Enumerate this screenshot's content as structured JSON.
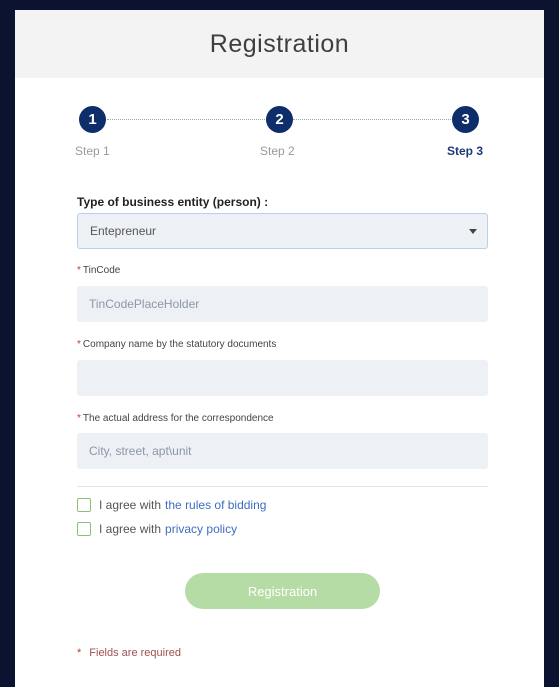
{
  "header": {
    "title": "Registration"
  },
  "steps": [
    {
      "number": "1",
      "label": "Step 1"
    },
    {
      "number": "2",
      "label": "Step 2"
    },
    {
      "number": "3",
      "label": "Step 3"
    }
  ],
  "form": {
    "entity_label": "Type of business entity (person) :",
    "entity_value": "Entepreneur",
    "tincode_label": "TinCode",
    "tincode_placeholder": "TinCodePlaceHolder",
    "company_label": "Company name by the statutory documents",
    "company_placeholder": "",
    "address_label": "The actual address for the correspondence",
    "address_placeholder": "City, street, apt\\unit",
    "required_star": "*"
  },
  "agreements": {
    "bidding_text": "I agree with",
    "bidding_link": "the rules of bidding",
    "privacy_text": "I agree with",
    "privacy_link": "privacy policy"
  },
  "submit": {
    "label": "Registration"
  },
  "footer": {
    "required_note": "Fields are required"
  },
  "colors": {
    "page_background": "#0b1330",
    "step_circle": "#0d2e6b",
    "button": "#b6dca6",
    "link": "#3d6fc0",
    "required": "#c0392b"
  }
}
